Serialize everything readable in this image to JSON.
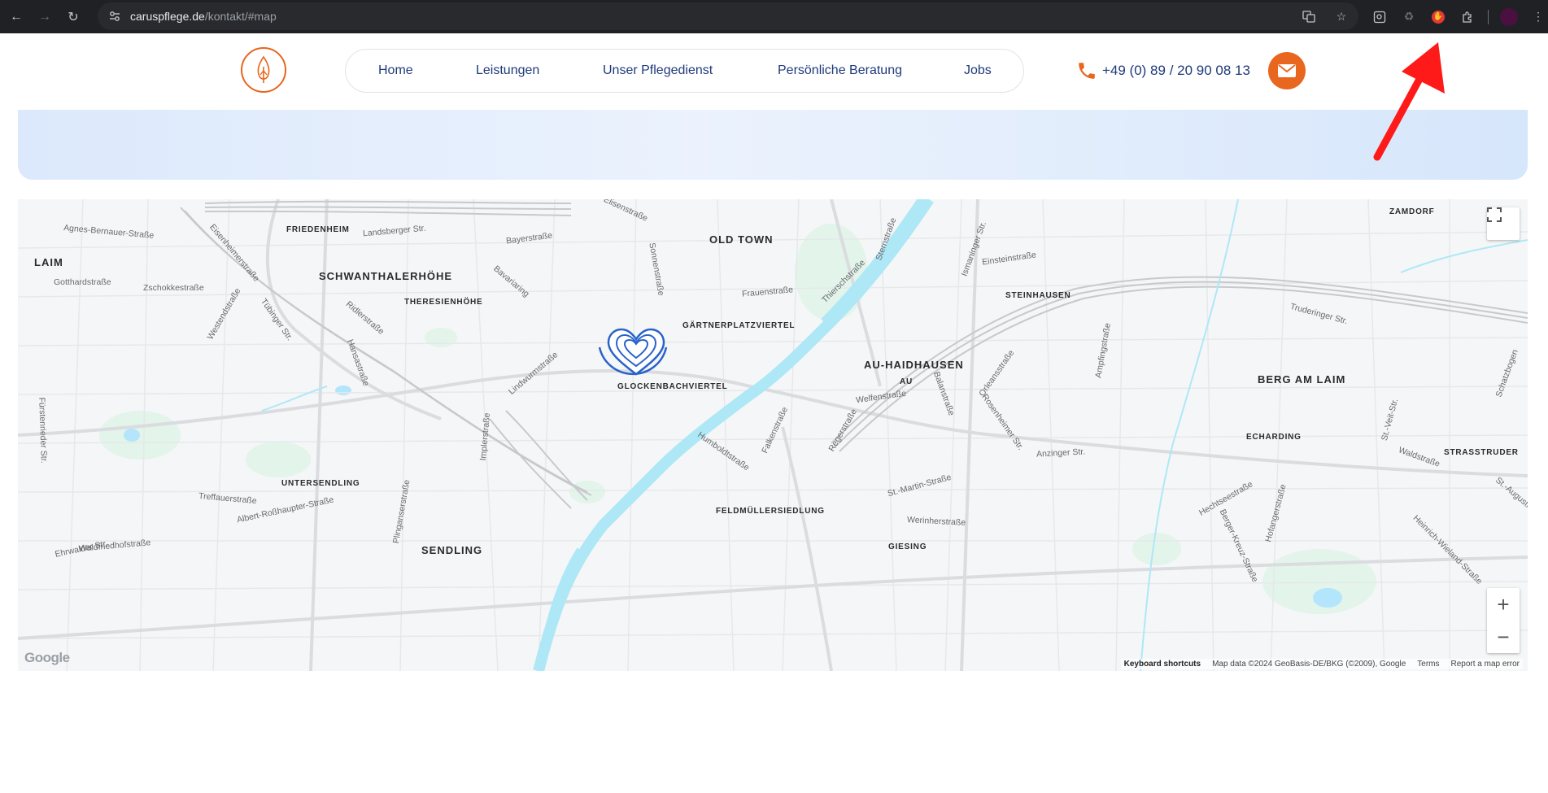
{
  "browser": {
    "url_host": "caruspflege.de",
    "url_path": "/kontakt/#map",
    "back_icon": "arrow-left-icon",
    "forward_icon": "arrow-right-icon",
    "reload_icon": "reload-icon"
  },
  "header": {
    "nav": [
      "Home",
      "Leistungen",
      "Unser Pflegedienst",
      "Persönliche Beratung",
      "Jobs"
    ],
    "phone": "+49 (0) 89 / 20 90 08 13",
    "brand_color": "#e8661d",
    "nav_color": "#1f3a7a"
  },
  "map": {
    "districts": [
      "FRIEDENHEIM",
      "OLD TOWN",
      "ZAMDORF",
      "LAIM",
      "SCHWANTHALERHÖHE",
      "THERESIENHÖHE",
      "STEINHAUSEN",
      "GÄRTNERPLATZVIERTEL",
      "AU-HAIDHAUSEN",
      "BERG AM LAIM",
      "AU",
      "GLOCKENBACHVIERTEL",
      "ECHARDING",
      "STRASSTRUDER",
      "UNTERSENDLING",
      "FELDMÜLLERSIEDLUNG",
      "GIESING",
      "SENDLING"
    ],
    "streets": [
      "Agnes-Bernauer-Straße",
      "Landsberger Str.",
      "Bayerstraße",
      "Elisenstraße",
      "Eisenheimerstraße",
      "Gotthardstraße",
      "Zschokkestraße",
      "Bavariaring",
      "Sonnenstraße",
      "Frauenstraße",
      "Thierschstraße",
      "Sternstraße",
      "Ismaninger Str.",
      "Einsteinstraße",
      "Westendstraße",
      "Tübinger Str.",
      "Ridlerstraße",
      "Hansastraße",
      "Lindwurmstraße",
      "Balanstraße",
      "Orleansstraße",
      "Truderinger Str.",
      "Fürstenrieder Str.",
      "Implerstraße",
      "Humboldtstraße",
      "Falkenstraße",
      "Regerstraße",
      "Welfenstraße",
      "Rosenheimer Str.",
      "Anzinger Str.",
      "Ampfingstraße",
      "St.-Veit-Str.",
      "Waldstraße",
      "Ehrwalder Str.",
      "Treffauerstraße",
      "Albert-Roßhaupter-Straße",
      "Waldfriedhofstraße",
      "Plinganserstraße",
      "St.-Martin-Straße",
      "Werinherstraße",
      "Hechtseestraße",
      "Berger-Kreuz-Straße",
      "Hofangerstraße",
      "Heinrich-Wieland-Straße",
      "Schatzbogen",
      "St.-Augustinus",
      "Ehrwalder Str."
    ],
    "fullscreen_icon": "fullscreen-icon",
    "zoom_in": "+",
    "zoom_out": "−",
    "google": "Google",
    "attribution": {
      "keyboard": "Keyboard shortcuts",
      "data": "Map data ©2024 GeoBasis-DE/BKG (©2009), Google",
      "terms": "Terms",
      "report": "Report a map error"
    },
    "marker_icon": "heart-marker-icon"
  }
}
